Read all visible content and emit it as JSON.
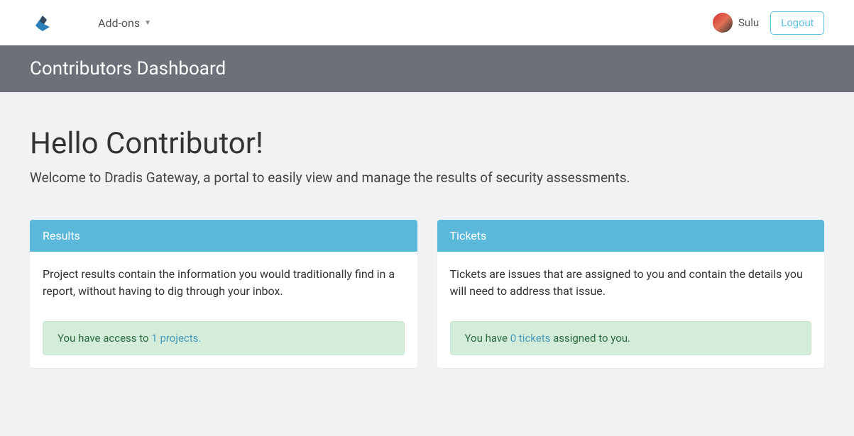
{
  "navbar": {
    "addons_label": "Add-ons",
    "username": "Sulu",
    "logout_label": "Logout"
  },
  "header": {
    "title": "Contributors Dashboard"
  },
  "main": {
    "greeting": "Hello Contributor!",
    "subtitle": "Welcome to Dradis Gateway, a portal to easily view and manage the results of security assessments."
  },
  "cards": {
    "results": {
      "title": "Results",
      "text": "Project results contain the information you would traditionally find in a report, without having to dig through your inbox.",
      "alert_prefix": "You have access to ",
      "alert_link": "1 projects."
    },
    "tickets": {
      "title": "Tickets",
      "text": "Tickets are issues that are assigned to you and contain the details you will need to address that issue.",
      "alert_prefix": "You have ",
      "alert_link": "0 tickets",
      "alert_suffix": " assigned to you."
    }
  }
}
